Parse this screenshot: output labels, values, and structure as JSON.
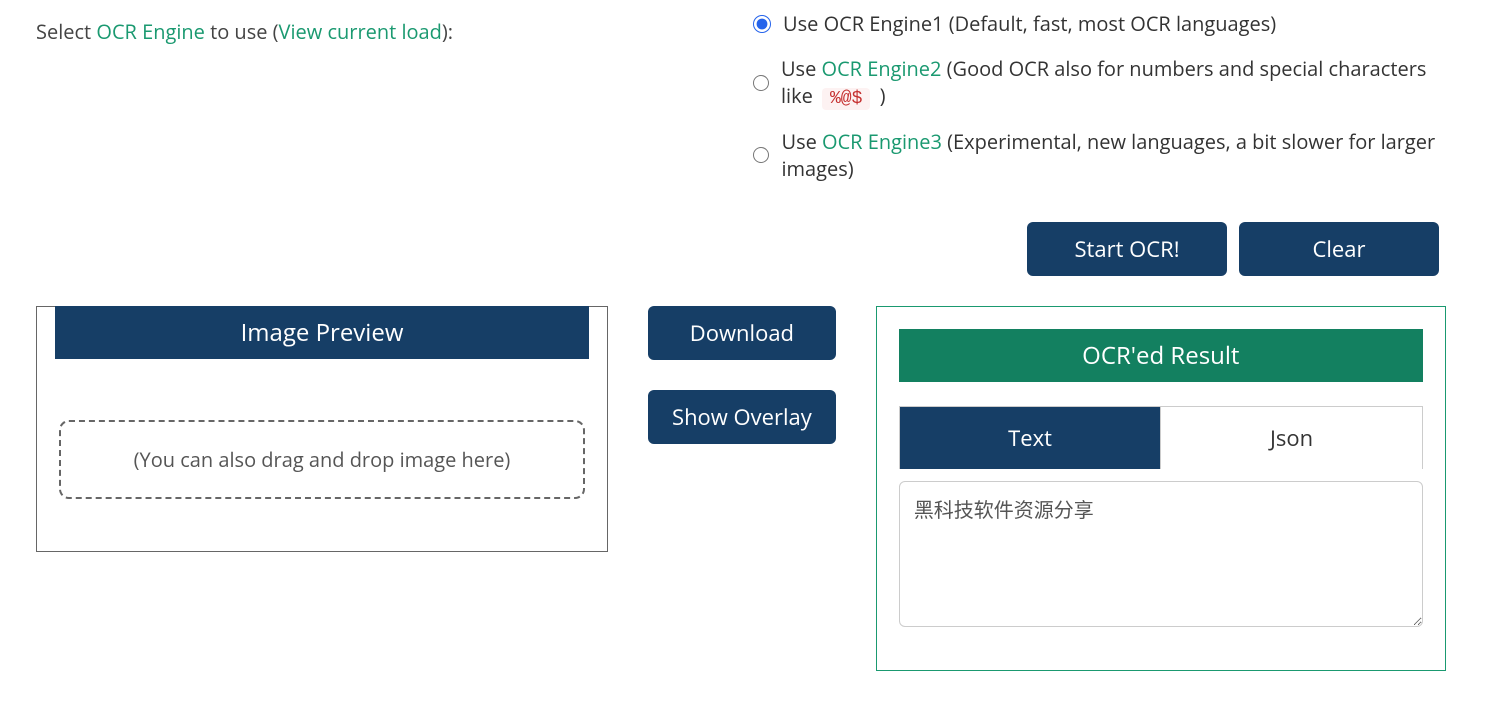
{
  "selectLabel": {
    "prefix": "Select ",
    "engineLink": "OCR Engine",
    "mid": " to use (",
    "loadLink": "View current load",
    "suffix": "):"
  },
  "engines": [
    {
      "checked": true,
      "prefix": "Use OCR Engine1 (Default, fast, most OCR languages)",
      "link": "",
      "desc": "",
      "badge": "",
      "tail": ""
    },
    {
      "checked": false,
      "prefix": "Use ",
      "link": "OCR Engine2",
      "desc": " (Good OCR also for numbers and special characters like ",
      "badge": "%@$",
      "tail": " )"
    },
    {
      "checked": false,
      "prefix": "Use ",
      "link": "OCR Engine3",
      "desc": " (Experimental, new languages, a bit slower for larger images)",
      "badge": "",
      "tail": ""
    }
  ],
  "actions": {
    "startOcr": "Start OCR!",
    "clear": "Clear"
  },
  "imagePreview": {
    "title": "Image Preview",
    "dropHint": "(You can also drag and drop image here)"
  },
  "middle": {
    "download": "Download",
    "showOverlay": "Show Overlay"
  },
  "result": {
    "title": "OCR'ed Result",
    "tabText": "Text",
    "tabJson": "Json",
    "textValue": "黑科技软件资源分享"
  }
}
